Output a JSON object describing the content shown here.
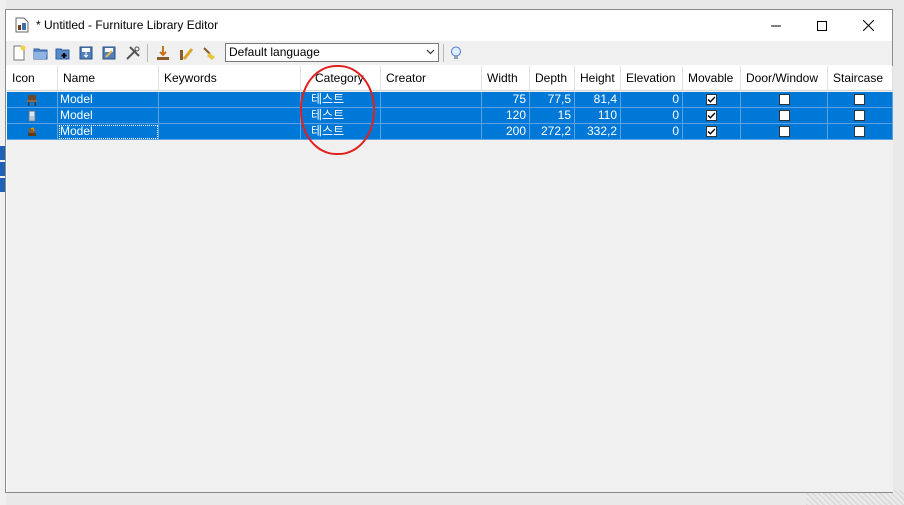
{
  "window": {
    "title": "* Untitled - Furniture Library Editor"
  },
  "toolbar": {
    "language_selected": "Default language",
    "buttons": [
      "new-library-icon",
      "open-library-icon",
      "merge-library-icon",
      "save-icon",
      "save-as-icon",
      "preferences-icon",
      "import-furniture-icon",
      "modify-furniture-icon",
      "delete-furniture-icon",
      "help-icon"
    ]
  },
  "table": {
    "columns": [
      "Icon",
      "Name",
      "Keywords",
      "Category",
      "Creator",
      "Width",
      "Depth",
      "Height",
      "Elevation",
      "Movable",
      "Door/Window",
      "Staircase"
    ],
    "rows": [
      {
        "name": "Model",
        "keywords": "",
        "category": "테스트",
        "creator": "",
        "width": "75",
        "depth": "77,5",
        "height": "81,4",
        "elevation": "0",
        "movable": true,
        "door_window": false,
        "staircase": false
      },
      {
        "name": "Model",
        "keywords": "",
        "category": "테스트",
        "creator": "",
        "width": "120",
        "depth": "15",
        "height": "110",
        "elevation": "0",
        "movable": true,
        "door_window": false,
        "staircase": false
      },
      {
        "name": "Model",
        "keywords": "",
        "category": "테스트",
        "creator": "",
        "width": "200",
        "depth": "272,2",
        "height": "332,2",
        "elevation": "0",
        "movable": true,
        "door_window": false,
        "staircase": false
      }
    ]
  },
  "colors": {
    "selection": "#0078d7",
    "annotation": "#e0211e"
  }
}
